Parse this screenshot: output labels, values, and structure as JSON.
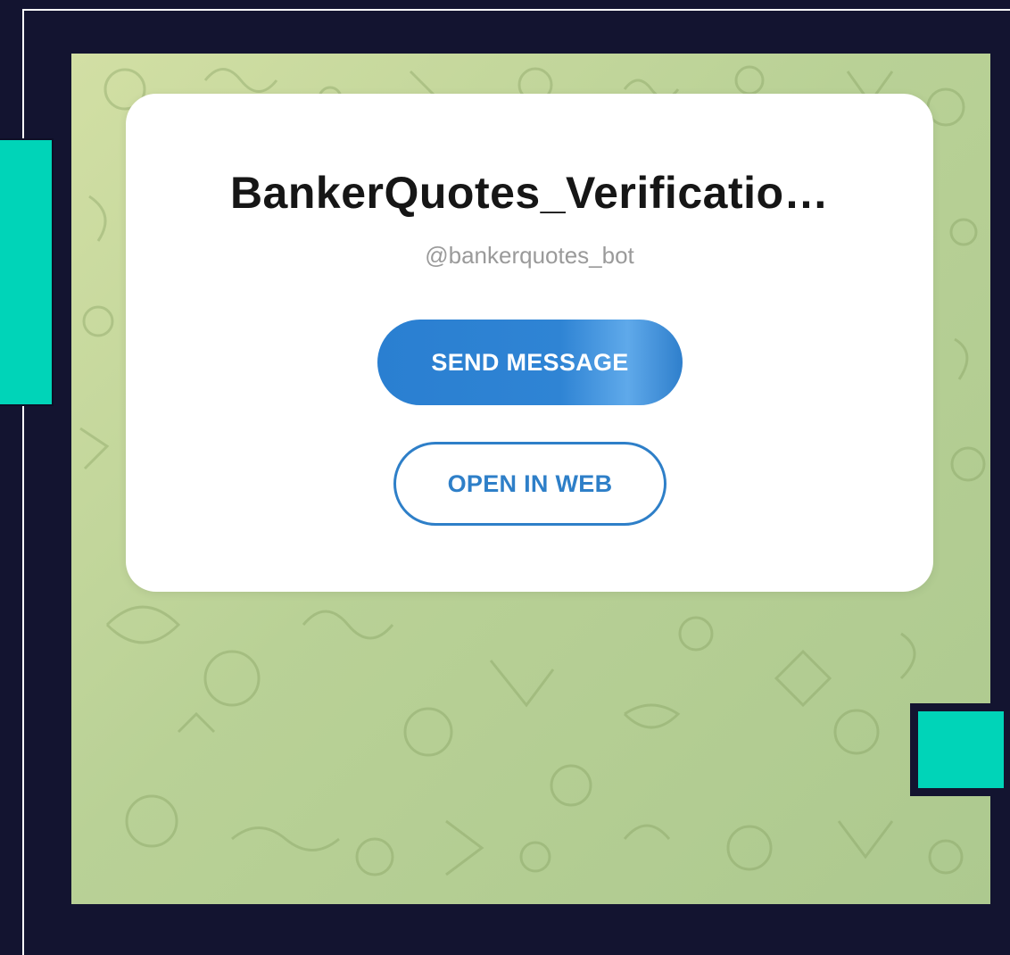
{
  "bot_card": {
    "title": "BankerQuotes_Verificatio…",
    "username": "@bankerquotes_bot",
    "send_message_label": "SEND MESSAGE",
    "open_in_web_label": "OPEN IN WEB"
  },
  "colors": {
    "page_background": "#131430",
    "accent": "#00d4b8",
    "button_blue": "#2a7fd1",
    "wallpaper": "#c1d69b"
  },
  "decor": {
    "wallpaper_pattern": "doodle-pattern"
  }
}
